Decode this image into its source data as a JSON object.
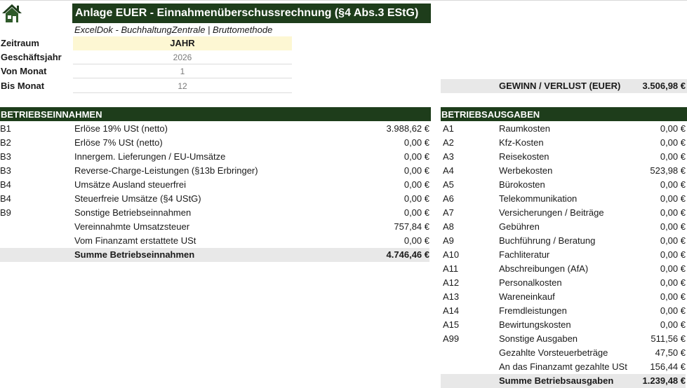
{
  "header": {
    "title": "Anlage EUER - Einnahmenüberschussrechnung (§4 Abs.3 EStG)",
    "subtitle": "ExcelDok - BuchhaltungZentrale | Bruttomethode"
  },
  "params": {
    "zeitraum_label": "Zeitraum",
    "zeitraum_value": "JAHR",
    "geschaeftsjahr_label": "Geschäftsjahr",
    "geschaeftsjahr_value": "2026",
    "von_monat_label": "Von Monat",
    "von_monat_value": "1",
    "bis_monat_label": "Bis Monat",
    "bis_monat_value": "12"
  },
  "profit": {
    "label": "GEWINN / VERLUST (EUER)",
    "value": "3.506,98 €"
  },
  "income": {
    "heading": "BETRIEBSEINNAHMEN",
    "rows": [
      {
        "code": "B1",
        "label": "Erlöse 19% USt (netto)",
        "amount": "3.988,62 €"
      },
      {
        "code": "B2",
        "label": "Erlöse 7% USt (netto)",
        "amount": "0,00 €"
      },
      {
        "code": "B3",
        "label": "Innergem. Lieferungen / EU-Umsätze",
        "amount": "0,00 €"
      },
      {
        "code": "B3",
        "label": "Reverse-Charge-Leistungen (§13b Erbringer)",
        "amount": "0,00 €"
      },
      {
        "code": "B4",
        "label": "Umsätze Ausland steuerfrei",
        "amount": "0,00 €"
      },
      {
        "code": "B4",
        "label": "Steuerfreie Umsätze (§4 UStG)",
        "amount": "0,00 €"
      },
      {
        "code": "B9",
        "label": "Sonstige Betriebseinnahmen",
        "amount": "0,00 €"
      },
      {
        "code": "",
        "label": "Vereinnahmte Umsatzsteuer",
        "amount": "757,84 €"
      },
      {
        "code": "",
        "label": "Vom Finanzamt erstattete USt",
        "amount": "0,00 €"
      }
    ],
    "sum_label": "Summe Betriebseinnahmen",
    "sum_value": "4.746,46 €"
  },
  "expenses": {
    "heading": "BETRIEBSAUSGABEN",
    "rows": [
      {
        "code": "A1",
        "label": "Raumkosten",
        "amount": "0,00 €"
      },
      {
        "code": "A2",
        "label": "Kfz-Kosten",
        "amount": "0,00 €"
      },
      {
        "code": "A3",
        "label": "Reisekosten",
        "amount": "0,00 €"
      },
      {
        "code": "A4",
        "label": "Werbekosten",
        "amount": "523,98 €"
      },
      {
        "code": "A5",
        "label": "Bürokosten",
        "amount": "0,00 €"
      },
      {
        "code": "A6",
        "label": "Telekommunikation",
        "amount": "0,00 €"
      },
      {
        "code": "A7",
        "label": "Versicherungen / Beiträge",
        "amount": "0,00 €"
      },
      {
        "code": "A8",
        "label": "Gebühren",
        "amount": "0,00 €"
      },
      {
        "code": "A9",
        "label": "Buchführung / Beratung",
        "amount": "0,00 €"
      },
      {
        "code": "A10",
        "label": "Fachliteratur",
        "amount": "0,00 €"
      },
      {
        "code": "A11",
        "label": "Abschreibungen (AfA)",
        "amount": "0,00 €"
      },
      {
        "code": "A12",
        "label": "Personalkosten",
        "amount": "0,00 €"
      },
      {
        "code": "A13",
        "label": "Wareneinkauf",
        "amount": "0,00 €"
      },
      {
        "code": "A14",
        "label": "Fremdleistungen",
        "amount": "0,00 €"
      },
      {
        "code": "A15",
        "label": "Bewirtungskosten",
        "amount": "0,00 €"
      },
      {
        "code": "A99",
        "label": "Sonstige Ausgaben",
        "amount": "511,56 €"
      },
      {
        "code": "",
        "label": "Gezahlte Vorsteuerbeträge",
        "amount": "47,50 €"
      },
      {
        "code": "",
        "label": "An das Finanzamt gezahlte USt",
        "amount": "156,44 €"
      }
    ],
    "sum_label": "Summe Betriebsausgaben",
    "sum_value": "1.239,48 €"
  },
  "icons": {
    "home": "home-icon"
  },
  "colors": {
    "header_green": "#1e3d1b",
    "param_highlight": "#fdf7d3",
    "sum_gray": "#e8e8e8"
  }
}
